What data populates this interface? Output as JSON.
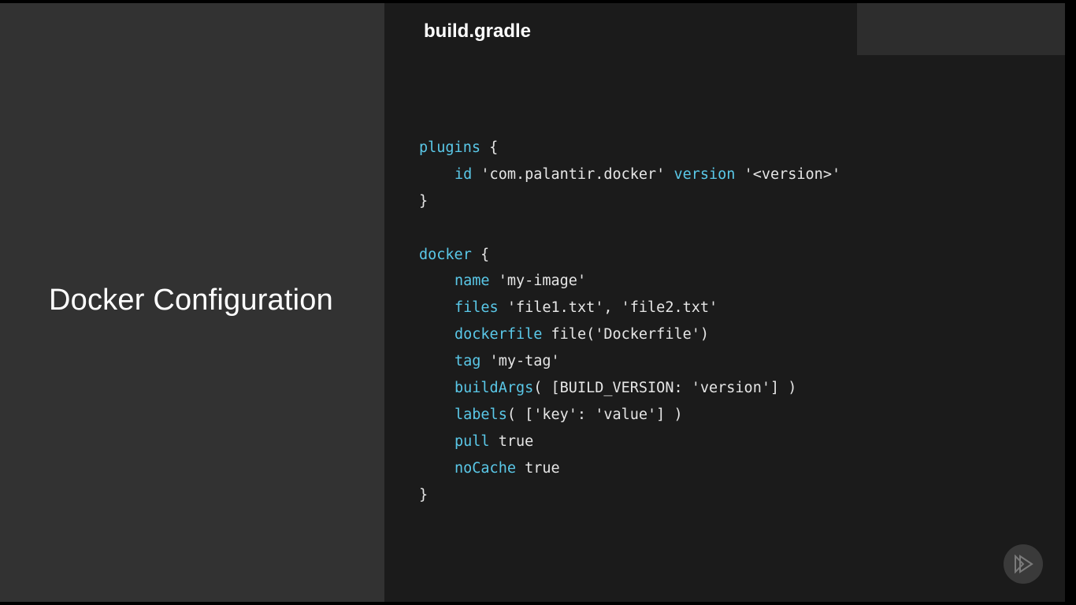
{
  "slide": {
    "title": "Docker Configuration",
    "file_name": "build.gradle"
  },
  "code": {
    "plugins_kw": "plugins",
    "plugins_open": " {",
    "id_kw": "id",
    "id_value": " 'com.palantir.docker' ",
    "version_kw": "version",
    "version_value": " '<version>'",
    "plugins_close": "}",
    "docker_kw": "docker",
    "docker_open": " {",
    "name_kw": "name",
    "name_value": " 'my-image'",
    "files_kw": "files",
    "files_value": " 'file1.txt', 'file2.txt'",
    "dockerfile_kw": "dockerfile",
    "dockerfile_value": " file('Dockerfile')",
    "tag_kw": "tag",
    "tag_value": " 'my-tag'",
    "buildargs_kw": "buildArgs",
    "buildargs_value": "( [BUILD_VERSION: 'version'] )",
    "labels_kw": "labels",
    "labels_value": "( ['key': 'value'] )",
    "pull_kw": "pull",
    "pull_value": " true",
    "nocache_kw": "noCache",
    "nocache_value": " true",
    "docker_close": "}"
  },
  "icons": {
    "player": "play-logo-icon"
  },
  "colors": {
    "left_background": "#323232",
    "right_background": "#1b1b1b",
    "keyword": "#5ac8e8",
    "text": "#e6e6e6"
  }
}
